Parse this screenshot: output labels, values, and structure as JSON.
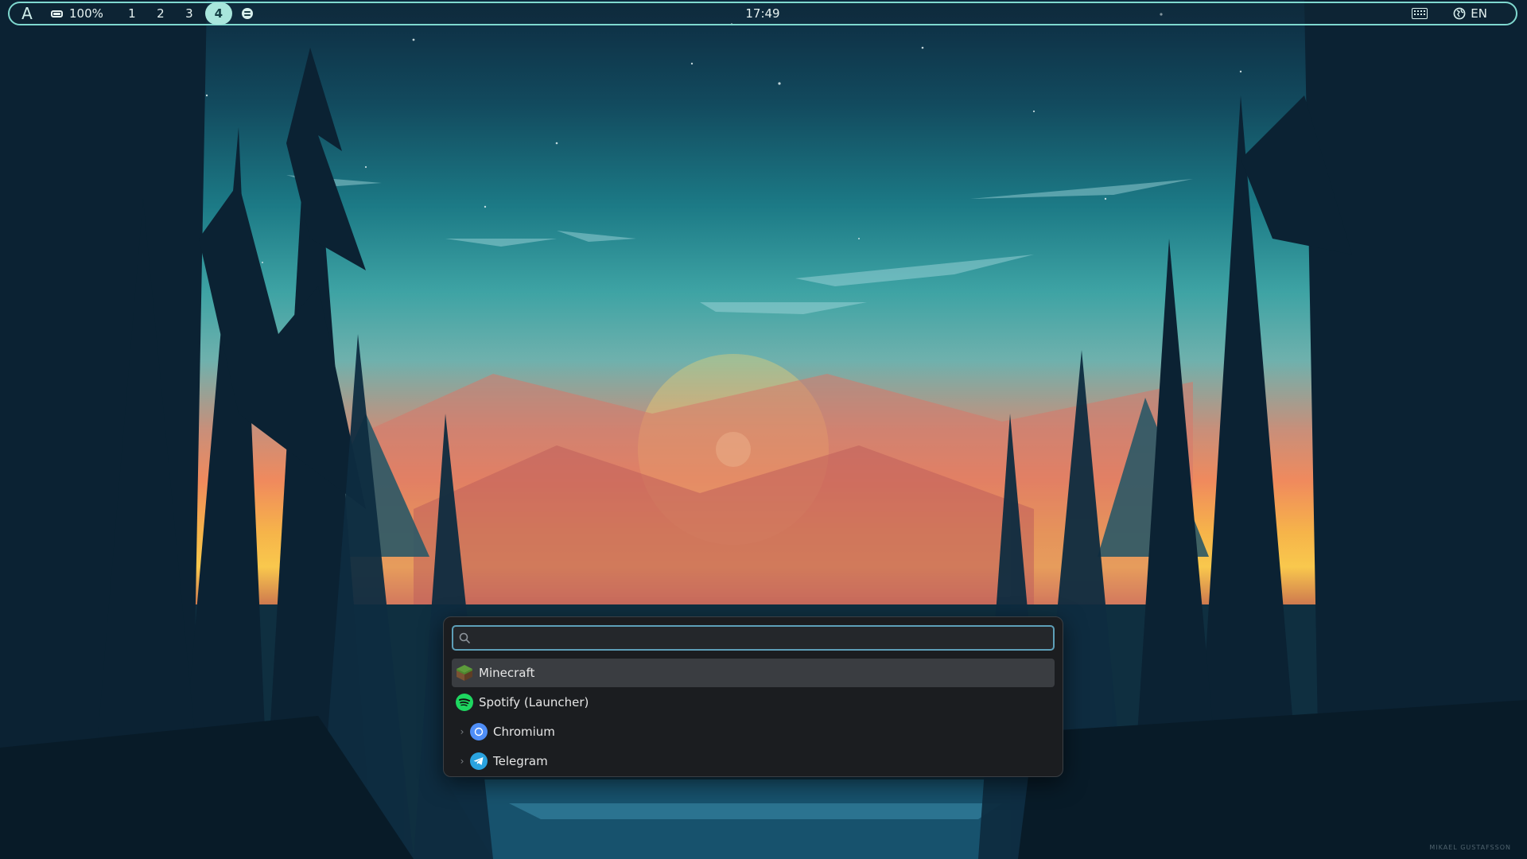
{
  "topbar": {
    "battery_label": "100%",
    "workspaces": [
      "1",
      "2",
      "3",
      "4"
    ],
    "active_workspace": "4",
    "clock": "17:49",
    "language": "EN",
    "tray_app_icon": "spotify-icon",
    "accent_color": "#7fd8cf"
  },
  "launcher": {
    "search": {
      "value": "",
      "placeholder": ""
    },
    "results": [
      {
        "label": "Minecraft",
        "icon": "minecraft-icon",
        "selected": true
      },
      {
        "label": "Spotify (Launcher)",
        "icon": "spotify-icon"
      },
      {
        "label": "Chromium",
        "icon": "chromium-icon",
        "expandable": true
      },
      {
        "label": "Telegram",
        "icon": "telegram-icon",
        "expandable": true
      }
    ],
    "accent_color": "#5d9fb8"
  },
  "wallpaper": {
    "signature": "MIKAEL GUSTAFSSON"
  }
}
